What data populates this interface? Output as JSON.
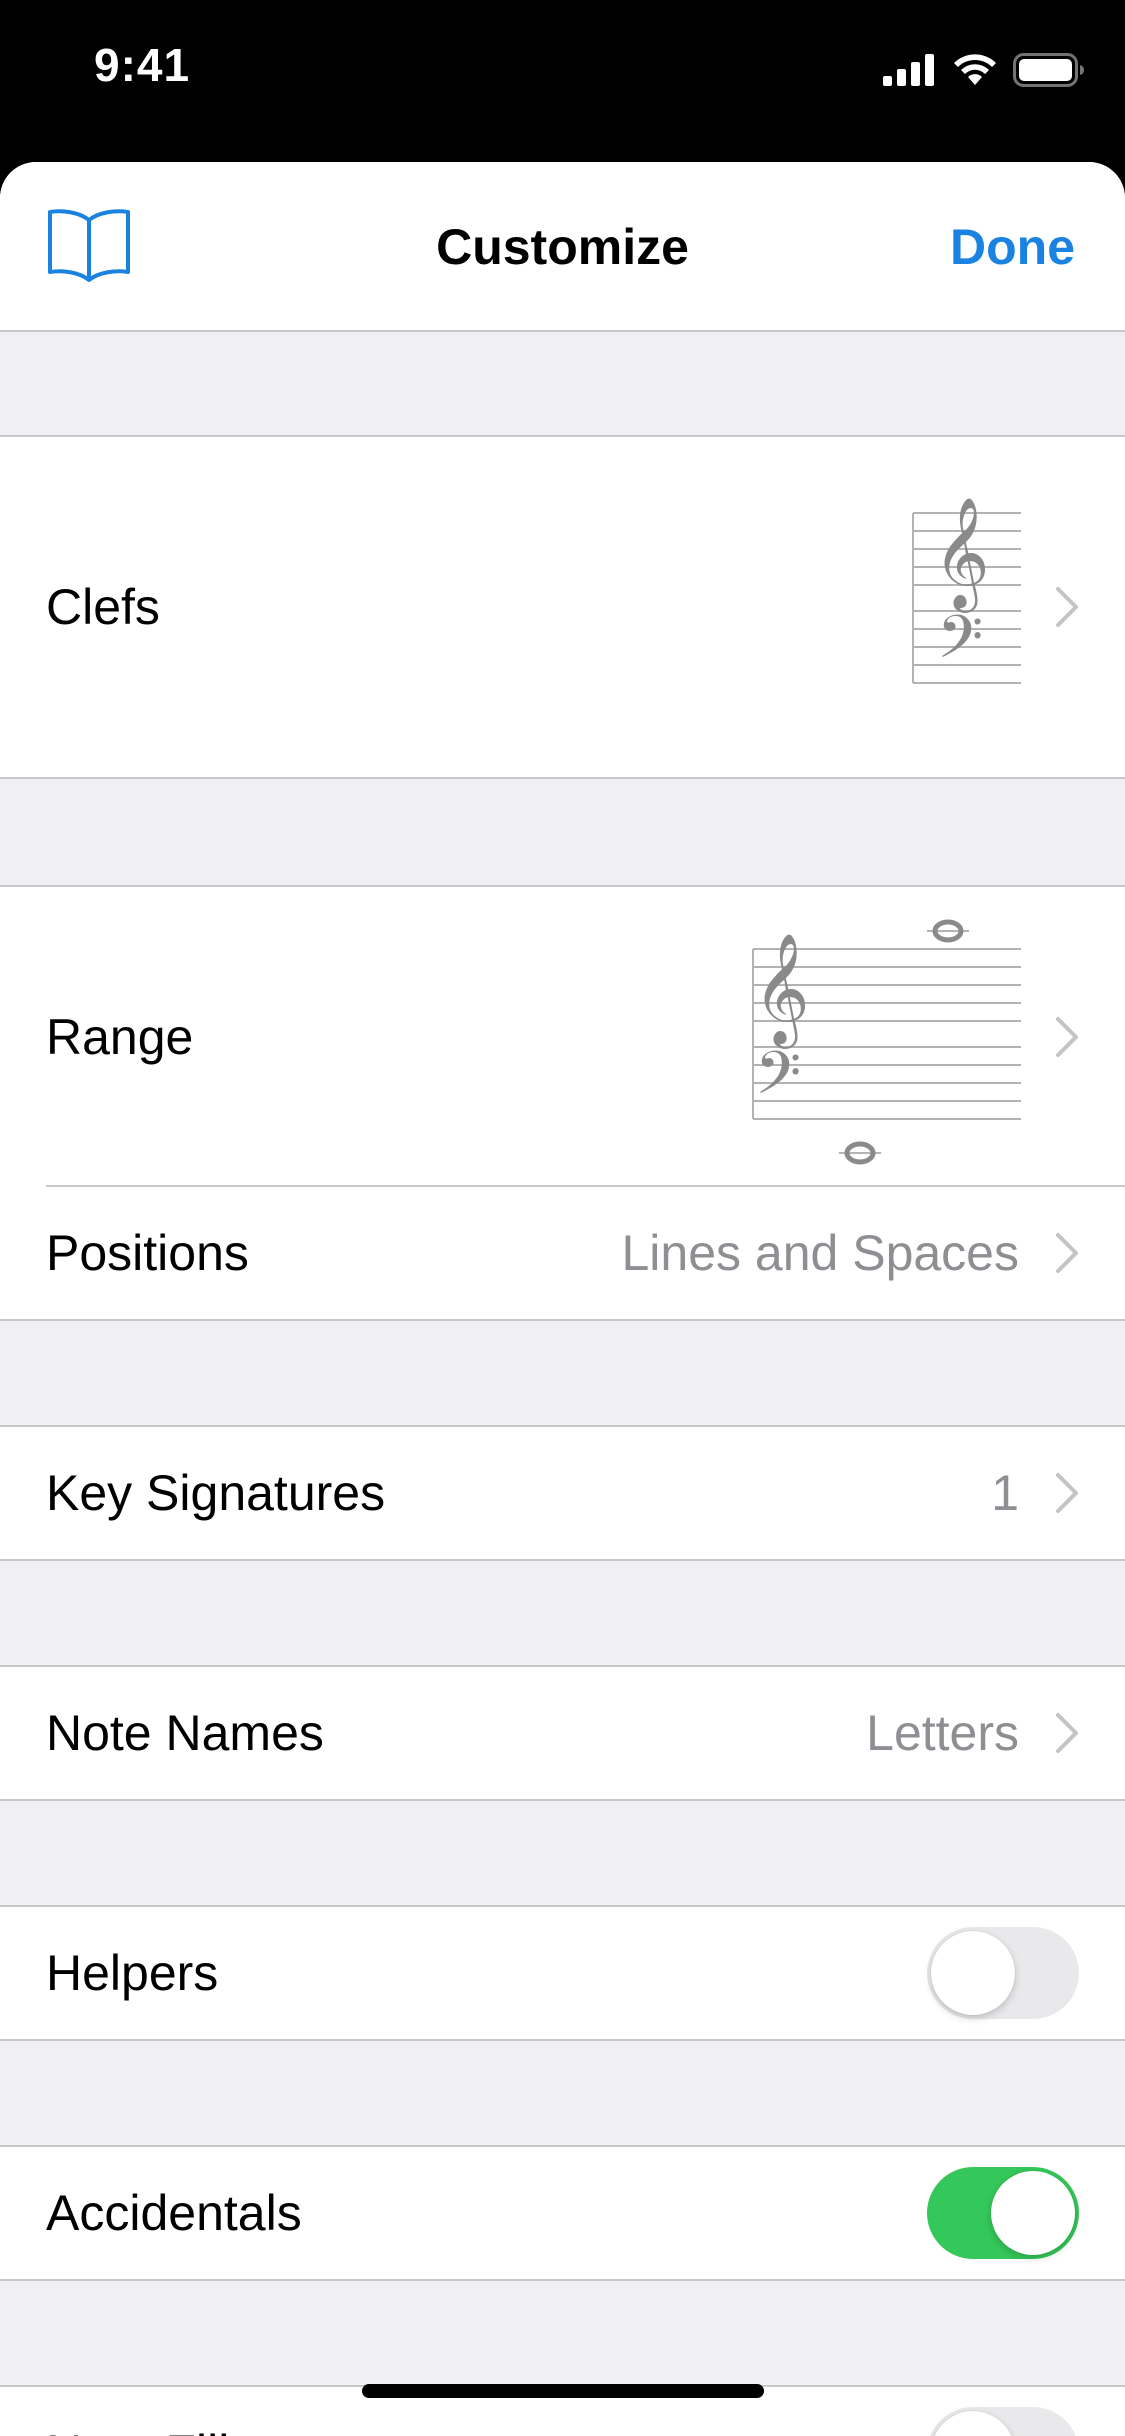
{
  "status_bar": {
    "time": "9:41",
    "icons": [
      "cellular-signal-icon",
      "wifi-icon",
      "battery-icon"
    ]
  },
  "nav": {
    "left_icon": "book-icon",
    "title": "Customize",
    "done_label": "Done"
  },
  "rows": {
    "clefs": {
      "label": "Clefs",
      "icon": "treble-bass-staff-icon"
    },
    "range": {
      "label": "Range",
      "icon": "range-staff-icon"
    },
    "positions": {
      "label": "Positions",
      "value": "Lines and Spaces"
    },
    "key_signatures": {
      "label": "Key Signatures",
      "value": "1"
    },
    "note_names": {
      "label": "Note Names",
      "value": "Letters"
    },
    "helpers": {
      "label": "Helpers",
      "toggle": false
    },
    "accidentals": {
      "label": "Accidentals",
      "toggle": true
    },
    "note_fills": {
      "label": "Note Fills",
      "toggle": false
    }
  },
  "colors": {
    "accent": "#1a82e0",
    "toggle_on": "#34c759",
    "toggle_off": "#e9e9eb",
    "grouped_background": "#efeff4",
    "secondary_text": "#8e8e93"
  }
}
